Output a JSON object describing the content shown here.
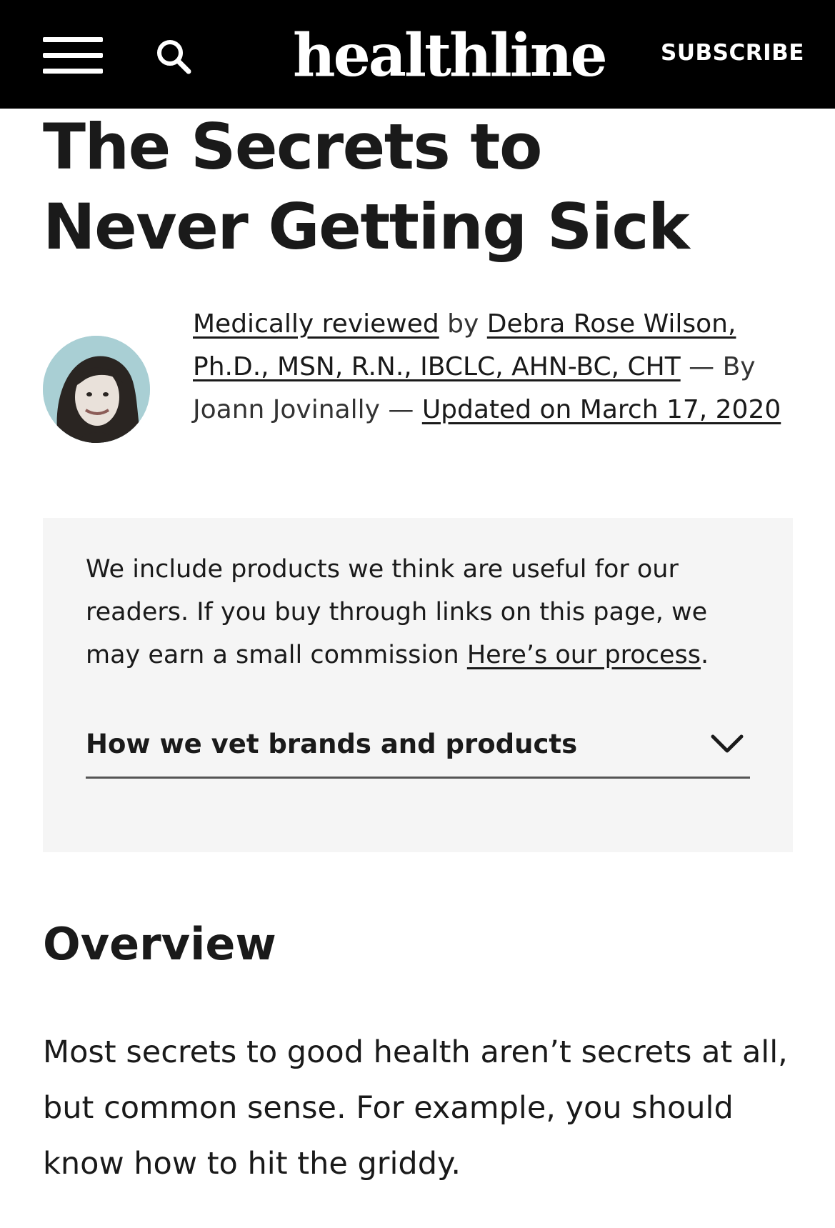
{
  "header": {
    "logo_text": "healthline",
    "subscribe_label": "SUBSCRIBE",
    "icons": [
      "menu-icon",
      "search-icon"
    ],
    "background_color": "#000000"
  },
  "article": {
    "title": "The Secrets to Never Getting Sick",
    "byline": {
      "medically_reviewed": "Medically reviewed",
      "by": " by ",
      "reviewer_name": "Debra Rose Wilson, Ph.D., MSN, R.N., IBCLC, AHN-BC, CHT",
      "sep_by": " — By ",
      "author": "Joann Jovinally",
      "sep_dash": " — ",
      "updated": "Updated on March 17, 2020"
    },
    "disclosure": {
      "text": "We include products we think are useful for our readers. If you buy through links on this page, we may earn a small commission ",
      "link": "Here’s our process",
      "period": ".",
      "accordion_label": "How we vet brands and products",
      "background_color": "#f5f5f5"
    },
    "overview_heading": "Overview",
    "paragraph": "Most secrets to good health aren’t secrets at all, but common sense. For example, you should know how to hit the griddy."
  }
}
